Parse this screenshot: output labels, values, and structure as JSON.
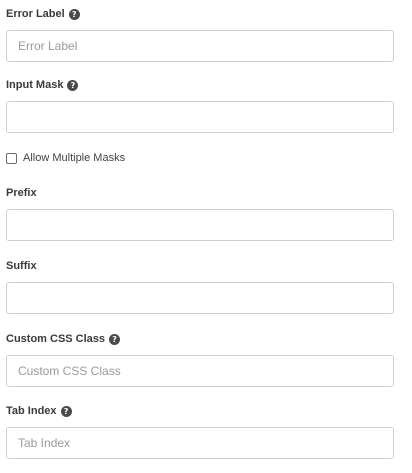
{
  "form": {
    "error_label": {
      "label": "Error Label",
      "help_icon": "question-circle-icon",
      "value": "",
      "placeholder": "Error Label"
    },
    "input_mask": {
      "label": "Input Mask",
      "help_icon": "question-circle-icon",
      "value": "",
      "placeholder": ""
    },
    "allow_multiple_masks": {
      "label": "Allow Multiple Masks",
      "checked": false
    },
    "prefix": {
      "label": "Prefix",
      "value": "",
      "placeholder": ""
    },
    "suffix": {
      "label": "Suffix",
      "value": "",
      "placeholder": ""
    },
    "custom_css_class": {
      "label": "Custom CSS Class",
      "help_icon": "question-circle-icon",
      "value": "",
      "placeholder": "Custom CSS Class"
    },
    "tab_index": {
      "label": "Tab Index",
      "help_icon": "question-circle-icon",
      "value": "",
      "placeholder": "Tab Index"
    }
  },
  "colors": {
    "border": "#cfcfcf",
    "label_text": "#3a3a3a",
    "placeholder_text": "#9a9a9a",
    "help_icon_bg": "#4a4a4a"
  }
}
